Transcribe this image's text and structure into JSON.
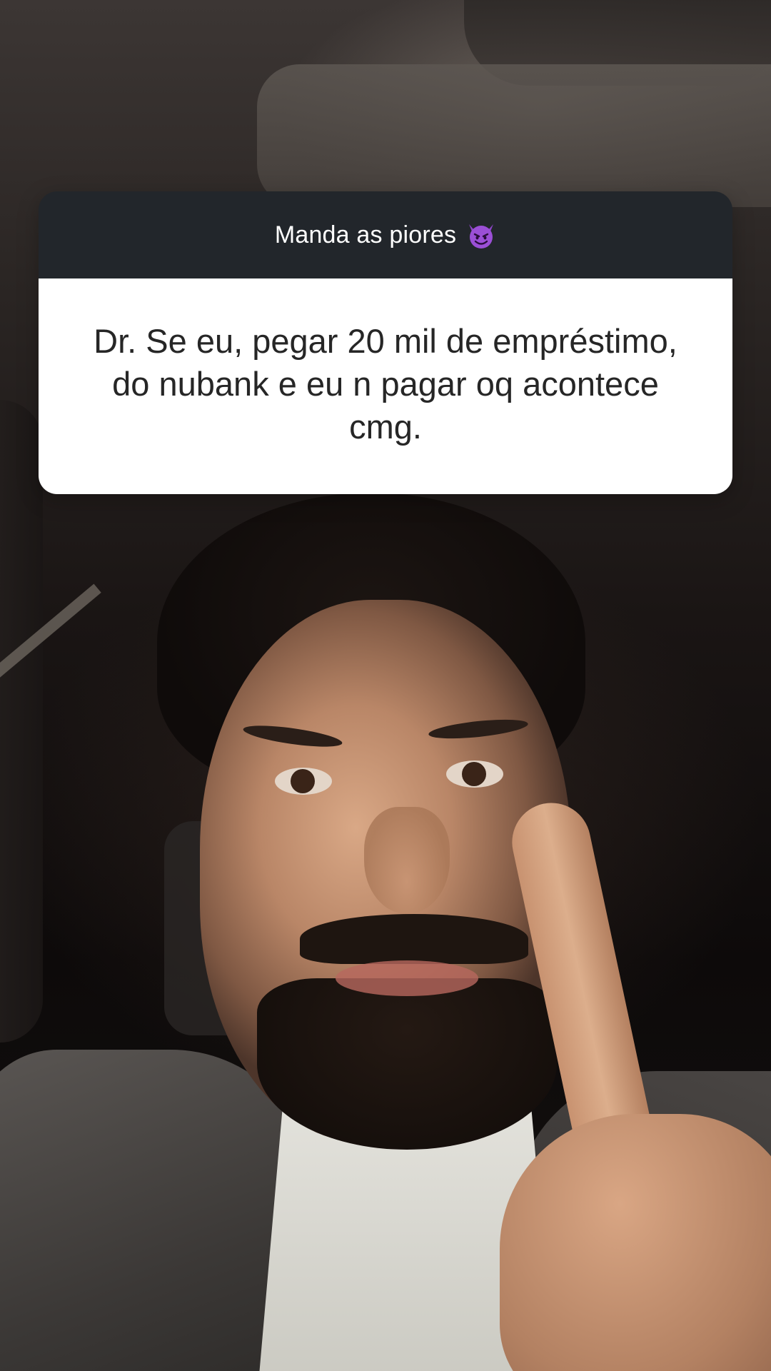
{
  "question_sticker": {
    "prompt": "Manda as piores",
    "prompt_icon": "smiling-devil-emoji-icon",
    "answer": "Dr. Se eu, pegar 20 mil de empréstimo, do nubank e eu n pagar oq acontece cmg."
  },
  "background": {
    "description_icon": "selfie-video-background"
  },
  "colors": {
    "header_bg": "#22262b",
    "body_bg": "#ffffff",
    "answer_text": "#262626",
    "emoji_purple": "#8e44c9"
  }
}
